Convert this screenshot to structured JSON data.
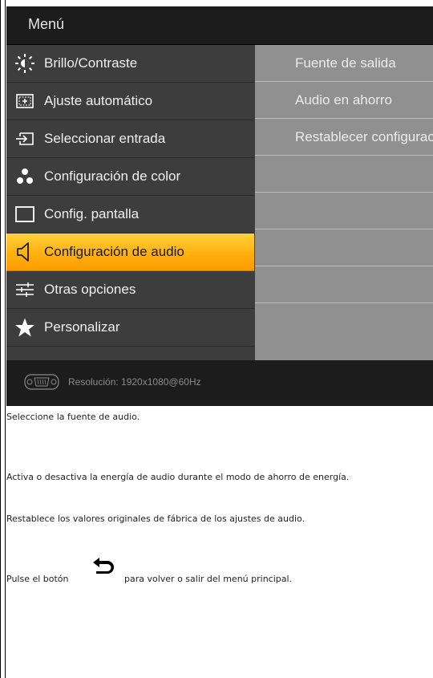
{
  "osd": {
    "title": "Menú",
    "menu_items": [
      {
        "label": "Brillo/Contraste",
        "icon": "brightness-icon"
      },
      {
        "label": "Ajuste automático",
        "icon": "auto-adjust-icon"
      },
      {
        "label": "Seleccionar entrada",
        "icon": "input-source-icon"
      },
      {
        "label": "Configuración de color",
        "icon": "color-settings-icon"
      },
      {
        "label": "Config. pantalla",
        "icon": "display-settings-icon"
      },
      {
        "label": "Configuración de audio",
        "icon": "speaker-icon",
        "selected": true
      },
      {
        "label": "Otras opciones",
        "icon": "sliders-icon"
      },
      {
        "label": "Personalizar",
        "icon": "star-icon"
      }
    ],
    "sub_items": [
      "Fuente de salida",
      "Audio en ahorro",
      "Restablecer configuración"
    ],
    "footer": {
      "resolution": "Resolución:  1920x1080@60Hz",
      "icon": "vga-connector-icon"
    },
    "colors": {
      "selected_bg": "#ffb00f",
      "panel_bg": "#3d3d3d",
      "sub_bg": "#909090"
    }
  },
  "descriptions": {
    "source": "Seleccione la fuente de audio.",
    "power_save": "Activa o desactiva la energía de audio durante el modo de ahorro de energía.",
    "reset": "Restablece los valores originales de fábrica de los ajustes de audio.",
    "back_pre": "Pulse el botón",
    "back_post": "para volver o salir del menú principal."
  }
}
